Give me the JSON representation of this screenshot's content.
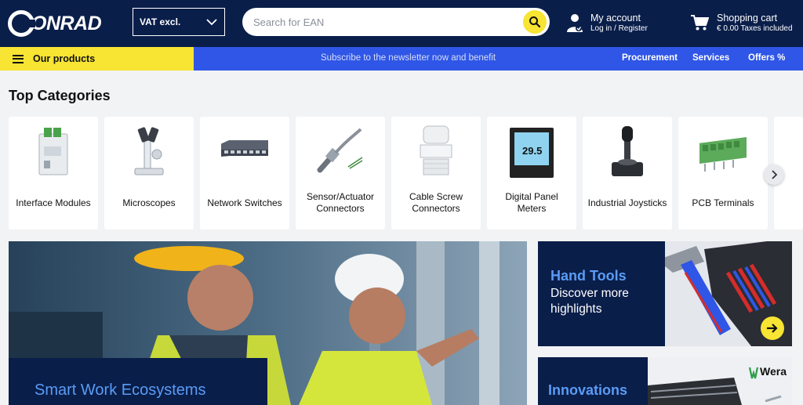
{
  "header": {
    "logo_text": "ONRAD",
    "vat_label": "VAT excl.",
    "search_placeholder": "Search for EAN",
    "account_title": "My account",
    "account_sub": "Log in / Register",
    "cart_title": "Shopping cart",
    "cart_sub": "€ 0.00 Taxes included"
  },
  "nav": {
    "products_label": "Our products",
    "newsletter": "Subscribe to the newsletter now and benefit",
    "links": [
      "Procurement",
      "Services",
      "Offers %"
    ]
  },
  "categories": {
    "title": "Top Categories",
    "items": [
      {
        "label": "Interface Modules",
        "icon": "interface-module-icon"
      },
      {
        "label": "Microscopes",
        "icon": "microscope-icon"
      },
      {
        "label": "Network Switches",
        "icon": "network-switch-icon"
      },
      {
        "label": "Sensor/Actuator Connectors",
        "icon": "sensor-connector-icon"
      },
      {
        "label": "Cable Screw Connectors",
        "icon": "cable-gland-icon"
      },
      {
        "label": "Digital Panel Meters",
        "icon": "panel-meter-icon"
      },
      {
        "label": "Industrial Joysticks",
        "icon": "joystick-icon"
      },
      {
        "label": "PCB Terminals",
        "icon": "pcb-terminal-icon"
      }
    ],
    "panel_meter_reading": "29.5"
  },
  "banners": {
    "hero_title": "Smart Work Ecosystems",
    "promo1_title": "Hand Tools",
    "promo1_text": "Discover more highlights",
    "promo2_title": "Innovations",
    "promo2_brand": "Wera"
  },
  "colors": {
    "header_bg": "#0a1e4a",
    "accent_yellow": "#f7e433",
    "nav_blue": "#2f56e6",
    "link_blue": "#5a9cf5"
  }
}
